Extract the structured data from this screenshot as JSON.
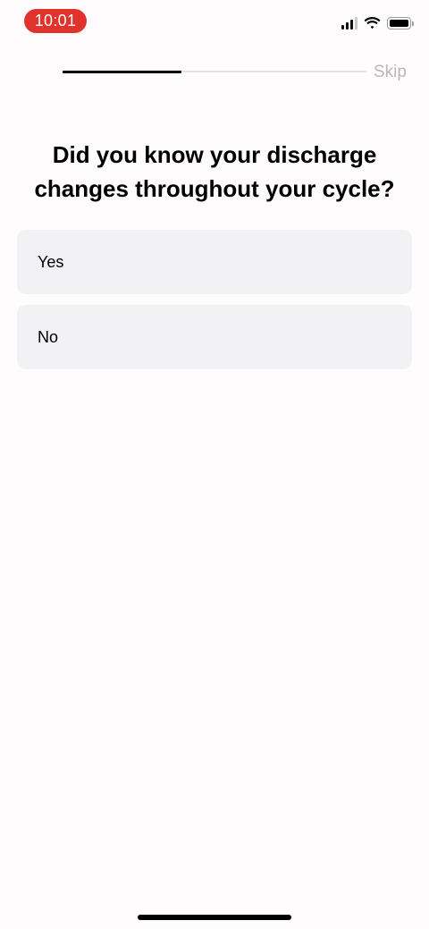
{
  "status_bar": {
    "time": "10:01",
    "signal_icon": "cellular-signal-icon",
    "wifi_icon": "wifi-icon",
    "battery_icon": "battery-icon"
  },
  "header": {
    "progress_percent": 39,
    "skip_label": "Skip"
  },
  "question": {
    "title": "Did you know your discharge changes throughout your cycle?"
  },
  "options": [
    {
      "label": "Yes"
    },
    {
      "label": "No"
    }
  ],
  "colors": {
    "background": "#fefcfd",
    "option_background": "#f2f2f5",
    "time_pill": "#e0332c",
    "skip_text": "#b8b8bc",
    "progress_track": "#e4e4e7",
    "progress_fill": "#000000"
  }
}
